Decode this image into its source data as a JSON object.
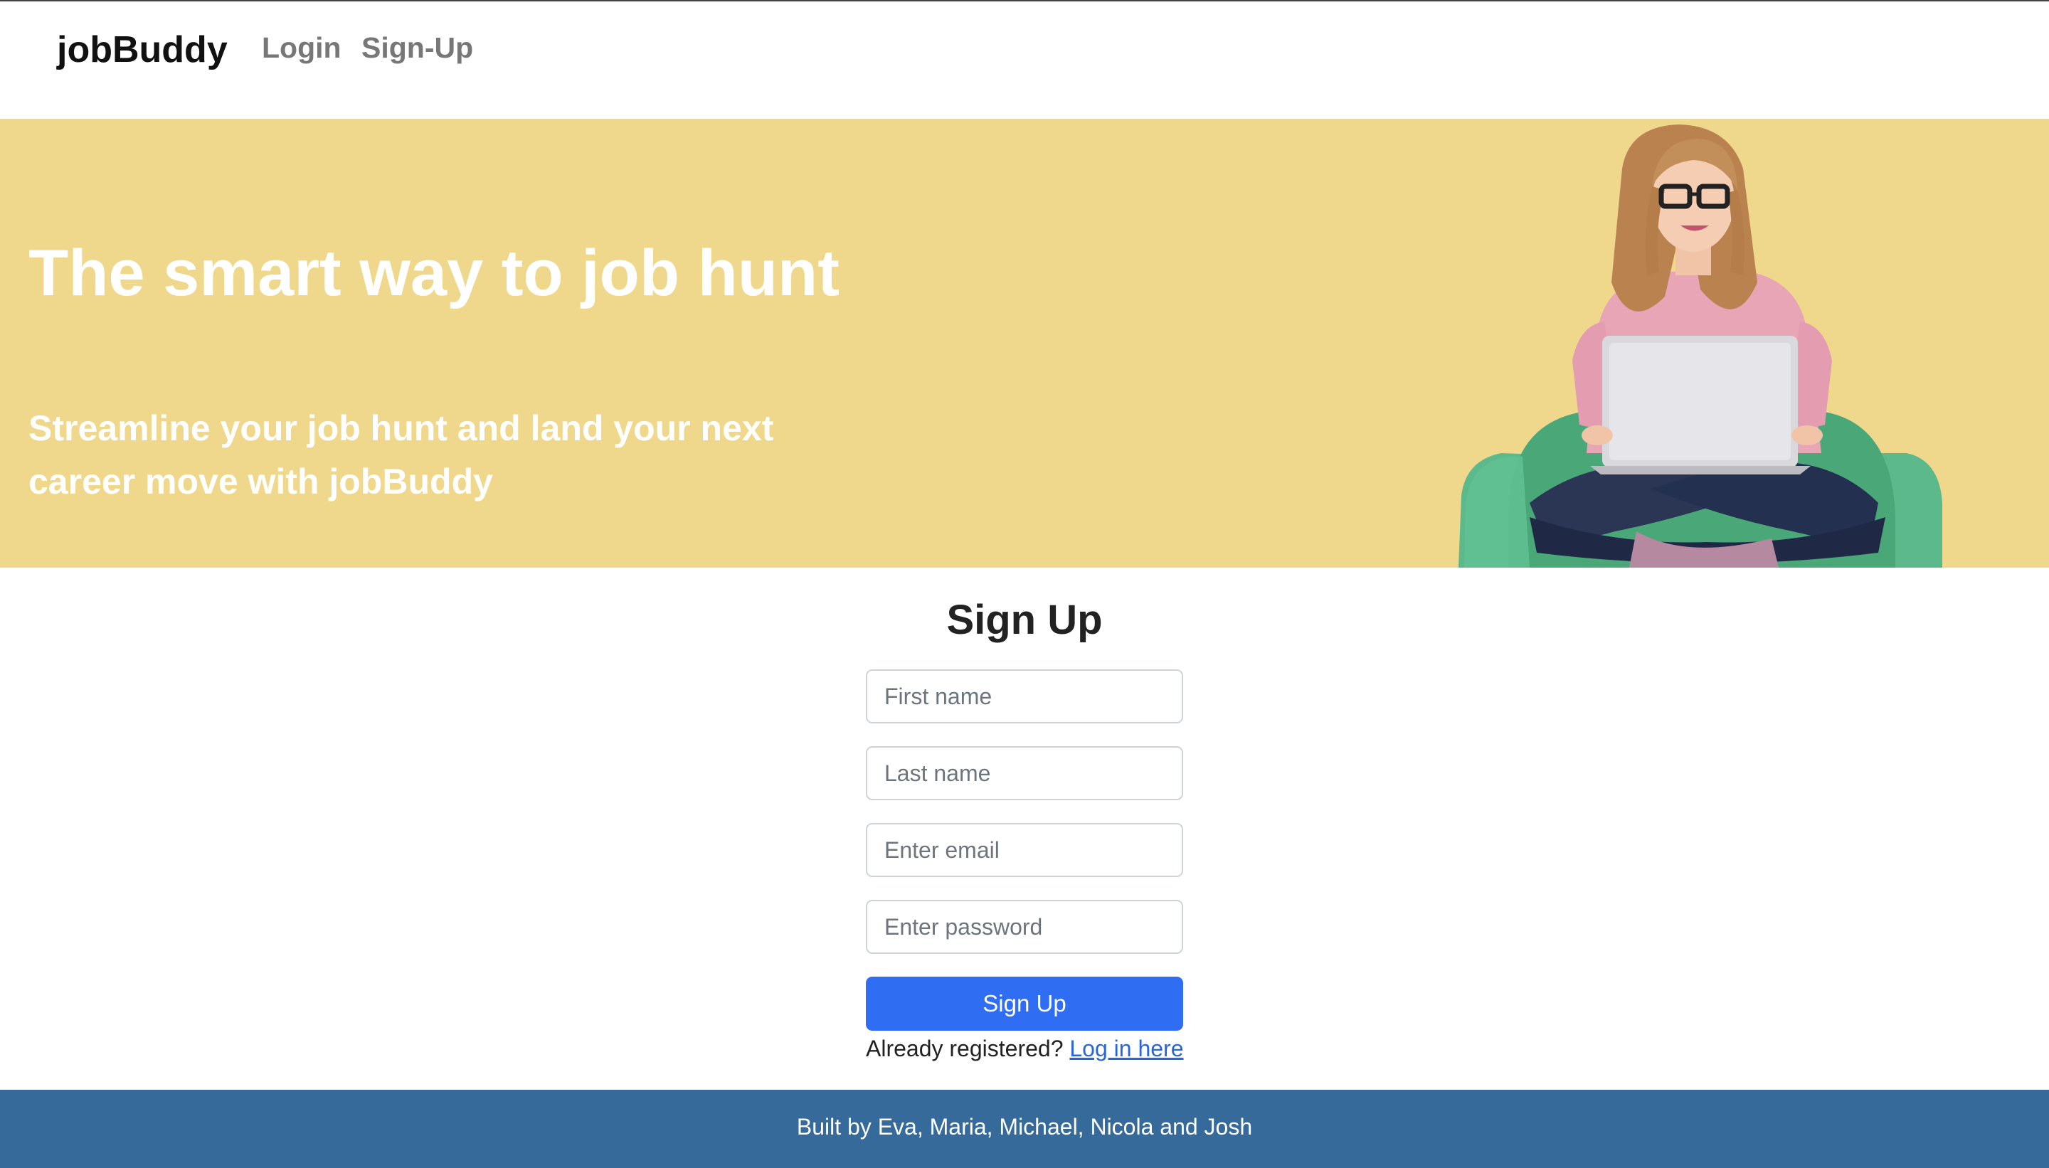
{
  "navbar": {
    "brand": "jobBuddy",
    "links": [
      {
        "label": "Login"
      },
      {
        "label": "Sign-Up"
      }
    ]
  },
  "hero": {
    "title": "The smart way to job hunt",
    "subtitle": "Streamline your job hunt and land your next career move with jobBuddy",
    "background_color": "#efd88b",
    "illustration": "woman-with-laptop-in-armchair"
  },
  "signup_form": {
    "title": "Sign Up",
    "fields": [
      {
        "placeholder": "First name",
        "value": ""
      },
      {
        "placeholder": "Last name",
        "value": ""
      },
      {
        "placeholder": "Enter email",
        "value": ""
      },
      {
        "placeholder": "Enter password",
        "value": ""
      }
    ],
    "submit_label": "Sign Up",
    "login_prompt": "Already registered?",
    "login_link": "Log in here",
    "accent_color": "#2f6df3"
  },
  "footer": {
    "text": "Built by Eva, Maria, Michael, Nicola and Josh",
    "background_color": "#366a9a"
  }
}
